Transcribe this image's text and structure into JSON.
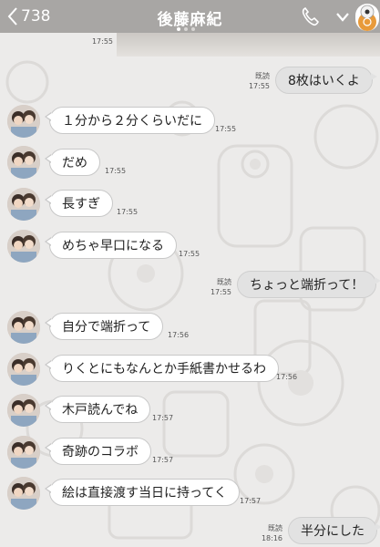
{
  "header": {
    "back_count": "738",
    "title": "後藤麻紀",
    "colors": {
      "bar": "#a8a6a4",
      "text": "#ffffff"
    },
    "icons": [
      "chevron-left-icon",
      "phone-icon",
      "chevron-down-icon",
      "sticker-avatar-icon"
    ]
  },
  "previous": {
    "status": "既読",
    "time": "17:55"
  },
  "messages": [
    {
      "side": "out",
      "text": "8枚はいくよ",
      "status": "既読",
      "time": "17:55"
    },
    {
      "side": "in",
      "text": "１分から２分くらいだに",
      "time": "17:55"
    },
    {
      "side": "in",
      "text": "だめ",
      "time": "17:55"
    },
    {
      "side": "in",
      "text": "長すぎ",
      "time": "17:55"
    },
    {
      "side": "in",
      "text": "めちゃ早口になる",
      "time": "17:55"
    },
    {
      "side": "out",
      "text": "ちょっと端折って！",
      "status": "既読",
      "time": "17:55"
    },
    {
      "side": "in",
      "text": "自分で端折って",
      "time": "17:56"
    },
    {
      "side": "in",
      "text": "りくとにもなんとか手紙書かせるわ",
      "time": "17:56"
    },
    {
      "side": "in",
      "text": "木戸読んでね",
      "time": "17:57"
    },
    {
      "side": "in",
      "text": "奇跡のコラボ",
      "time": "17:57"
    },
    {
      "side": "in",
      "text": "絵は直接渡す当日に持ってく",
      "time": "17:57"
    },
    {
      "side": "out",
      "text": "半分にした",
      "status": "既読",
      "time": "18:16"
    }
  ],
  "colors": {
    "background": "#ecebea",
    "incoming_bubble": "#ffffff",
    "outgoing_bubble": "#e2e2e2"
  }
}
